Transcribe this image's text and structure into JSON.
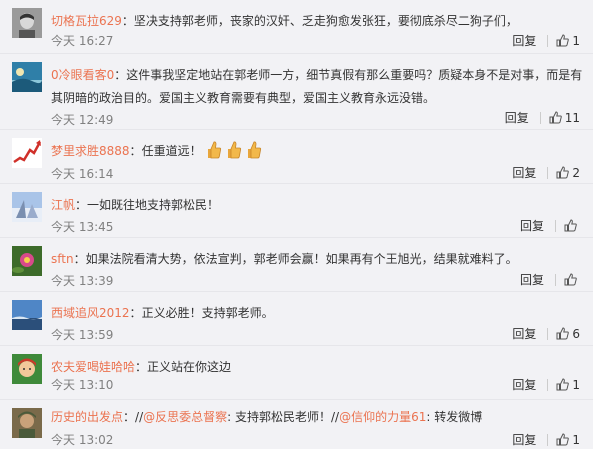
{
  "comments": [
    {
      "user": "切格瓦拉629",
      "text": "坚决支持郭老师，丧家的汉奸、乏走狗愈发张狂，要彻底杀尽二狗子们，",
      "time": "今天 16:27",
      "reply_label": "回复",
      "likes": "1",
      "avatar_colors": [
        "#9a9a9a",
        "#d8d8d8"
      ]
    },
    {
      "user": "0冷眼看客0",
      "text": "这件事我坚定地站在郭老师一方，细节真假有那么重要吗？质疑本身不是对事，而是有其阴暗的政治目的。爱国主义教育需要有典型，爱国主义教育永远没错。",
      "time": "今天 12:49",
      "reply_label": "回复",
      "likes": "11",
      "avatar_colors": [
        "#2f7fa8",
        "#8cc7d9"
      ]
    },
    {
      "user": "梦里求胜8888",
      "text": "任重道远！",
      "emoji": [
        "thumbs-up-icon",
        "thumbs-up-icon",
        "thumbs-up-icon"
      ],
      "time": "今天 16:14",
      "reply_label": "回复",
      "likes": "2",
      "avatar_colors": [
        "#ffffff",
        "#d0302a"
      ]
    },
    {
      "user": "江帆",
      "text": "一如既往地支持郭松民！",
      "time": "今天 13:45",
      "reply_label": "回复",
      "likes": "",
      "avatar_colors": [
        "#a9c4e8",
        "#e8eef7"
      ]
    },
    {
      "user": "sftn",
      "text": "如果法院看清大势，依法宣判，郭老师会赢！如果再有个王旭光，结果就难料了。",
      "time": "今天 13:39",
      "reply_label": "回复",
      "likes": "",
      "avatar_colors": [
        "#3d6b2a",
        "#d84a8a"
      ]
    },
    {
      "user": "西域追风2012",
      "text": "正义必胜！支持郭老师。",
      "time": "今天 13:59",
      "reply_label": "回复",
      "likes": "6",
      "avatar_colors": [
        "#4f86c6",
        "#2b4f7a"
      ]
    },
    {
      "user": "农夫爱喝娃哈哈",
      "text": "正义站在你这边",
      "time": "今天 13:10",
      "reply_label": "回复",
      "likes": "1",
      "avatar_colors": [
        "#3f8a3a",
        "#c83a2a"
      ]
    },
    {
      "user": "历史的出发点",
      "text": "//@反思委总督察: 支持郭松民老师！//@信仰的力量61: 转发微博",
      "time": "今天 13:02",
      "reply_label": "回复",
      "likes": "1",
      "avatar_colors": [
        "#7a6a4a",
        "#4a5a3a"
      ]
    }
  ]
}
